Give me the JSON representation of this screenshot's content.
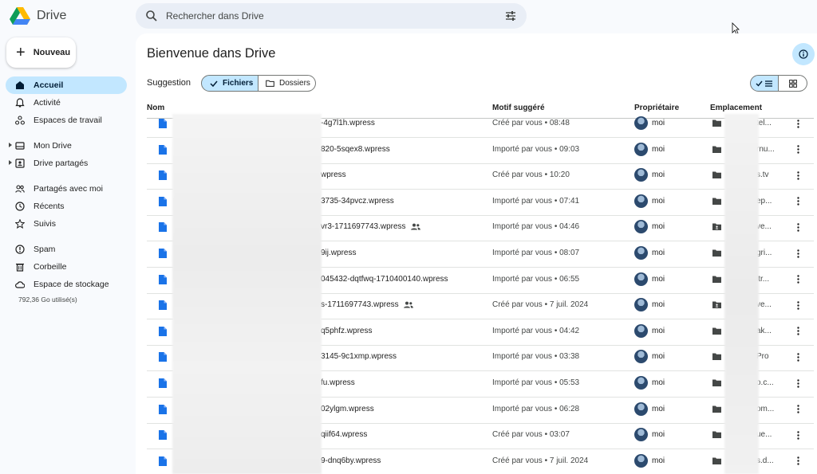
{
  "app": {
    "name": "Drive",
    "search_placeholder": "Rechercher dans Drive",
    "colors": {
      "accent": "#c2e7ff",
      "file_icon": "#1a73e8",
      "panel": "#ffffff",
      "background": "#f8fafd"
    }
  },
  "sidebar": {
    "new_label": "Nouveau",
    "items": [
      {
        "label": "Accueil",
        "icon": "home-icon",
        "active": true
      },
      {
        "label": "Activité",
        "icon": "bell-icon",
        "active": false
      },
      {
        "label": "Espaces de travail",
        "icon": "workspaces-icon",
        "active": false
      },
      {
        "label": "Mon Drive",
        "icon": "drive-icon",
        "active": false,
        "expandable": true
      },
      {
        "label": "Drive partagés",
        "icon": "shared-drive-icon",
        "active": false,
        "expandable": true
      },
      {
        "label": "Partagés avec moi",
        "icon": "people-icon",
        "active": false
      },
      {
        "label": "Récents",
        "icon": "clock-icon",
        "active": false
      },
      {
        "label": "Suivis",
        "icon": "star-icon",
        "active": false
      },
      {
        "label": "Spam",
        "icon": "spam-icon",
        "active": false
      },
      {
        "label": "Corbeille",
        "icon": "trash-icon",
        "active": false
      },
      {
        "label": "Espace de stockage",
        "icon": "cloud-icon",
        "active": false
      }
    ],
    "storage_used": "792,36 Go utilisé(s)"
  },
  "main": {
    "title": "Bienvenue dans Drive",
    "suggestion_label": "Suggestion",
    "filter_files": "Fichiers",
    "filter_folders": "Dossiers",
    "columns": {
      "name": "Nom",
      "reason": "Motif suggéré",
      "owner": "Propriétaire",
      "location": "Emplacement"
    },
    "files": [
      {
        "name": "-4g7l1h.wpress",
        "reason": "Créé par vous • 08:48",
        "owner": "moi",
        "location": "tel...",
        "shared": false,
        "shared_folder": false
      },
      {
        "name": "820-5sqex8.wpress",
        "reason": "Importé par vous • 09:03",
        "owner": "moi",
        "location": "rnu...",
        "shared": false,
        "shared_folder": false
      },
      {
        "name": "wpress",
        "reason": "Créé par vous • 10:20",
        "owner": "moi",
        "location": "s.tv",
        "shared": false,
        "shared_folder": false
      },
      {
        "name": "3735-34pvcz.wpress",
        "reason": "Importé par vous • 07:41",
        "owner": "moi",
        "location": "ep...",
        "shared": false,
        "shared_folder": false
      },
      {
        "name": "vr3-1711697743.wpress",
        "reason": "Importé par vous • 04:46",
        "owner": "moi",
        "location": "ve...",
        "shared": true,
        "shared_folder": true
      },
      {
        "name": "9ij.wpress",
        "reason": "Importé par vous • 08:07",
        "owner": "moi",
        "location": "gri...",
        "shared": false,
        "shared_folder": false
      },
      {
        "name": "045432-dqtfwq-1710400140.wpress",
        "reason": "Importé par vous • 06:55",
        "owner": "moi",
        "location": "itr...",
        "shared": false,
        "shared_folder": false
      },
      {
        "name": "s-1711697743.wpress",
        "reason": "Créé par vous • 7 juil. 2024",
        "owner": "moi",
        "location": "ve...",
        "shared": true,
        "shared_folder": true
      },
      {
        "name": "q5phfz.wpress",
        "reason": "Importé par vous • 04:42",
        "owner": "moi",
        "location": "ak...",
        "shared": false,
        "shared_folder": false
      },
      {
        "name": "3145-9c1xmp.wpress",
        "reason": "Importé par vous • 03:38",
        "owner": "moi",
        "location": "Pro",
        "shared": false,
        "shared_folder": false
      },
      {
        "name": "fu.wpress",
        "reason": "Importé par vous • 05:53",
        "owner": "moi",
        "location": "o.c...",
        "shared": false,
        "shared_folder": false
      },
      {
        "name": "02ylgm.wpress",
        "reason": "Importé par vous • 06:28",
        "owner": "moi",
        "location": "om...",
        "shared": false,
        "shared_folder": false
      },
      {
        "name": "qiif64.wpress",
        "reason": "Créé par vous • 03:07",
        "owner": "moi",
        "location": "ue...",
        "shared": false,
        "shared_folder": false
      },
      {
        "name": "9-dnq6by.wpress",
        "reason": "Créé par vous • 7 juil. 2024",
        "owner": "moi",
        "location": "s.d...",
        "shared": false,
        "shared_folder": false
      }
    ]
  }
}
